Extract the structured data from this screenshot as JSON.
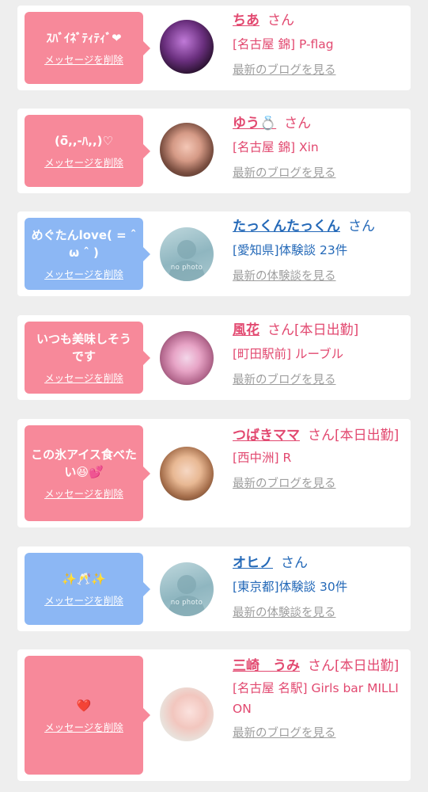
{
  "delete_label": "メッセージを削除",
  "cards": [
    {
      "message": "ｽﾊﾞｲﾈﾞﾃｨﾃｨﾞ❤",
      "name": "ちあ",
      "san": "さん",
      "details": [
        "[名古屋 錦] P-flag"
      ],
      "link": "最新のブログを見る"
    },
    {
      "message": "(ӧ̈,,-ﾊ,,)♡",
      "name": "ゆう💍",
      "san": "さん",
      "details": [
        "[名古屋 錦] Xin"
      ],
      "link": "最新のブログを見る"
    },
    {
      "message": "めぐたんlove( = ˆ ω ˆ )",
      "name": "たっくんたっくん",
      "san": "さん",
      "details": [
        "[愛知県]体験談 23件"
      ],
      "link": "最新の体験談を見る",
      "avatar_text": "no photo"
    },
    {
      "message": "いつも美味しそうです",
      "name": "風花",
      "san": "さん[本日出勤]",
      "details": [
        "[町田駅前] ルーブル"
      ],
      "link": "最新のブログを見る"
    },
    {
      "message": "この氷アイス食べたい😆💕",
      "name": "つばきママ",
      "san": "さん[本日出勤]",
      "details": [
        "[西中洲] R"
      ],
      "link": "最新のブログを見る"
    },
    {
      "message": "✨🥂✨",
      "name": "オヒノ",
      "san": "さん",
      "details": [
        "[東京都]体験談 30件"
      ],
      "link": "最新の体験談を見る",
      "avatar_text": "no photo"
    },
    {
      "message": "❤️",
      "name": "三崎　うみ",
      "san": "さん[本日出勤]",
      "details": [
        "[名古屋 名駅] Girls bar MILLION"
      ],
      "link": "最新のブログを見る"
    }
  ],
  "colors": {
    "pink_bubble": "#f7899a",
    "blue_bubble": "#8cb7f4",
    "pink_text": "#e24970",
    "blue_text": "#2469b8",
    "link_gray": "#9e9e9e"
  }
}
